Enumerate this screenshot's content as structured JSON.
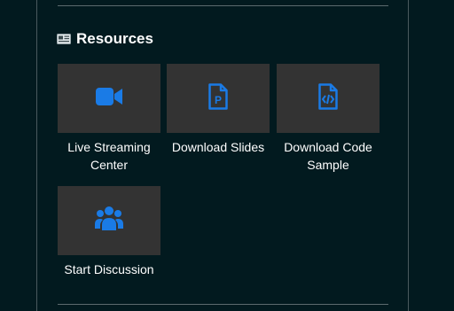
{
  "resources": {
    "title": "Resources",
    "items": [
      {
        "label": "Live Streaming Center",
        "icon": "video-camera-icon"
      },
      {
        "label": "Download Slides",
        "icon": "ppt-file-icon"
      },
      {
        "label": "Download Code Sample",
        "icon": "code-file-icon"
      },
      {
        "label": "Start Discussion",
        "icon": "users-group-icon"
      }
    ]
  },
  "colors": {
    "background": "#021a1f",
    "tile": "#333333",
    "icon_accent": "#1a7be6",
    "text": "#ffffff"
  }
}
